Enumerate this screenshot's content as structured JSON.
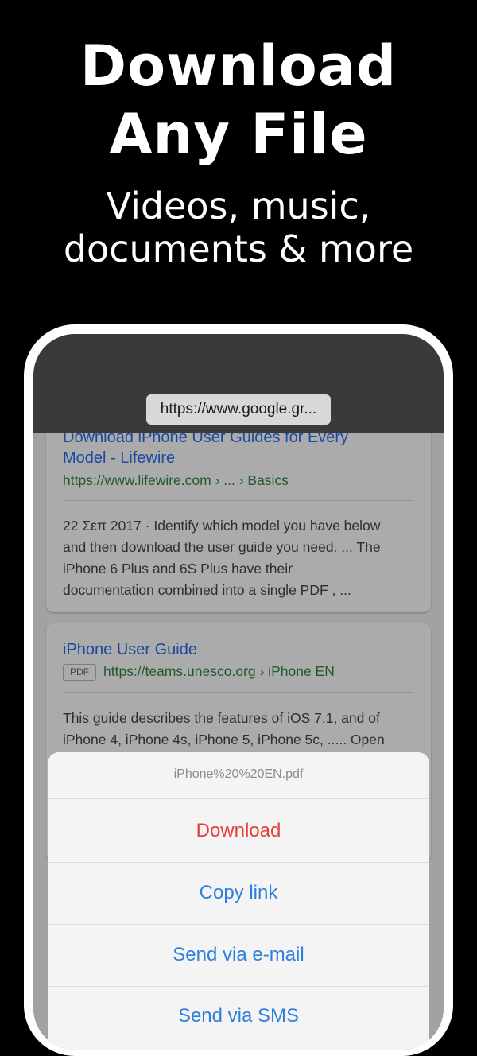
{
  "hero": {
    "title_line1": "Download",
    "title_line2": "Any File",
    "subtitle_line1": "Videos, music,",
    "subtitle_line2": "documents & more"
  },
  "browser": {
    "url": "https://www.google.gr..."
  },
  "results": [
    {
      "title": "Download iPhone User Guides for Every",
      "title_line2": "Model - Lifewire",
      "breadcrumb": "https://www.lifewire.com › ... › Basics",
      "snippet_lines": [
        "22 Σεπ 2017 · Identify which model you have below",
        "and then download the user guide you need. ... The",
        "iPhone 6 Plus and 6S Plus have their",
        "documentation combined into a single PDF , ..."
      ]
    },
    {
      "title": "iPhone User Guide",
      "badge": "PDF",
      "breadcrumb": "https://teams.unesco.org › iPhone EN",
      "snippet_lines": [
        "This guide describes the features of iOS 7.1, and of",
        "iPhone 4, iPhone 4s, iPhone 5, iPhone 5c, ..... Open"
      ]
    }
  ],
  "sheet": {
    "title": "iPhone%20%20EN.pdf",
    "actions": [
      {
        "label": "Download",
        "style": "destructive"
      },
      {
        "label": "Copy link",
        "style": "default"
      },
      {
        "label": "Send via e-mail",
        "style": "default"
      },
      {
        "label": "Send via SMS",
        "style": "default"
      }
    ]
  },
  "colors": {
    "background": "#000000",
    "link_blue": "#1a4aa0",
    "action_blue": "#2f7fdb",
    "action_red": "#e3403a",
    "url_green": "#1f5a2c"
  }
}
